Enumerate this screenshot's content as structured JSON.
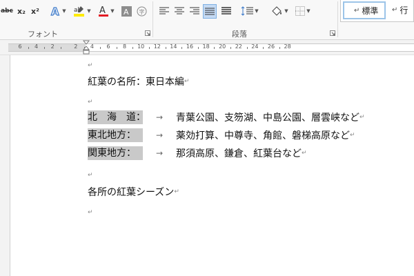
{
  "ribbon": {
    "font_group_label": "フォント",
    "paragraph_group_label": "段落",
    "buttons": {
      "strikethrough": "abc",
      "subscript": "x₂",
      "superscript": "x²"
    },
    "styles": {
      "normal_label": "標準",
      "next_label": "行",
      "paragraph_mark": "↵"
    },
    "colors": {
      "highlight": "#ffeb00",
      "font_color": "#e31b23",
      "active_justify": "#c5daf3"
    }
  },
  "ruler": {
    "ticks": [
      "6",
      "4",
      "2",
      "2",
      "4",
      "6",
      "8",
      "10",
      "12",
      "14",
      "16",
      "18",
      "20",
      "22",
      "24",
      "26",
      "28"
    ]
  },
  "document": {
    "paragraph_mark": "↵",
    "tab_mark": "→",
    "title": "紅葉の名所：東日本編",
    "rows": [
      {
        "region": "北　海　道：",
        "destinations": "青葉公園、支笏湖、中島公園、層雲峡など"
      },
      {
        "region": "東北地方：",
        "destinations": "薬効打算、中尊寺、角館、磐梯高原など"
      },
      {
        "region": "関東地方：",
        "destinations": "那須高原、鎌倉、紅葉台など"
      }
    ],
    "footer": "各所の紅葉シーズン"
  }
}
